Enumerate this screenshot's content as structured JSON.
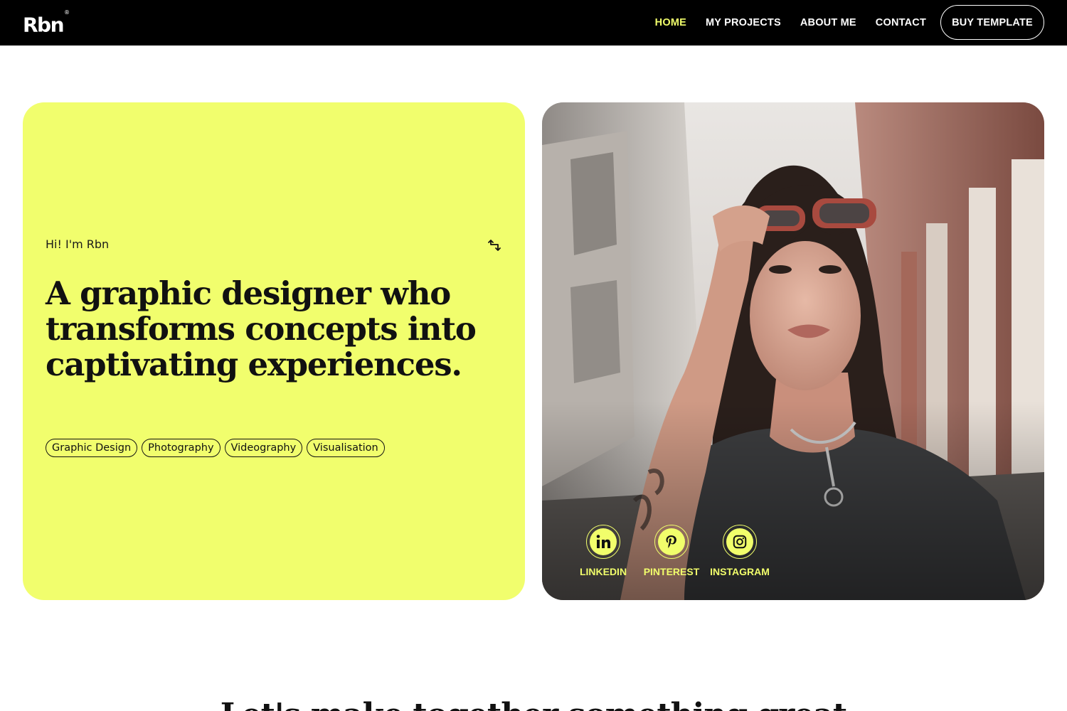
{
  "header": {
    "logo": "Rbn",
    "logo_mark": "®",
    "nav": [
      {
        "label": "HOME",
        "active": true
      },
      {
        "label": "MY PROJECTS",
        "active": false
      },
      {
        "label": "ABOUT ME",
        "active": false
      },
      {
        "label": "CONTACT",
        "active": false
      }
    ],
    "buy_label": "BUY TEMPLATE"
  },
  "intro": {
    "greeting": "Hi! I'm Rbn",
    "headline": "A graphic designer who transforms concepts into captivating experiences.",
    "tags": [
      "Graphic Design",
      "Photography",
      "Videography",
      "Visualisation"
    ],
    "corner_icon": "turn-arrow-icon"
  },
  "photo": {
    "socials": [
      {
        "label": "LINKEDIN",
        "icon": "linkedin-icon"
      },
      {
        "label": "PINTEREST",
        "icon": "pinterest-icon"
      },
      {
        "label": "INSTAGRAM",
        "icon": "instagram-icon"
      }
    ]
  },
  "section": {
    "heading": "Let's make together something great"
  },
  "colors": {
    "accent": "#f1fe6b",
    "header_bg": "#000000",
    "card_bg": "#f1fe6d"
  }
}
